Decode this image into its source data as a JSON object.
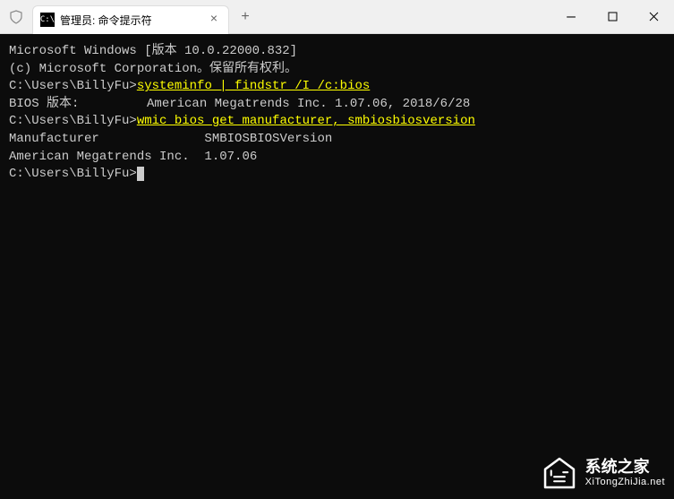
{
  "titlebar": {
    "tab_icon_text": "C:\\",
    "tab_title": "管理员: 命令提示符",
    "close_glyph": "×",
    "new_tab_glyph": "+",
    "minimize_glyph": "—",
    "maximize_glyph": "□",
    "window_close_glyph": "×"
  },
  "terminal": {
    "line1": "Microsoft Windows [版本 10.0.22000.832]",
    "line2": "(c) Microsoft Corporation。保留所有权利。",
    "blank": "",
    "prompt1_prefix": "C:\\Users\\BillyFu>",
    "cmd1": "systeminfo | findstr /I /c:bios",
    "out1": "BIOS 版本:         American Megatrends Inc. 1.07.06, 2018/6/28",
    "prompt2_prefix": "C:\\Users\\BillyFu>",
    "cmd2": "wmic bios get manufacturer, smbiosbiosversion",
    "out2a": "Manufacturer              SMBIOSBIOSVersion",
    "out2b": "American Megatrends Inc.  1.07.06",
    "prompt3_prefix": "C:\\Users\\BillyFu>"
  },
  "watermark": {
    "title": "系统之家",
    "url": "XiTongZhiJia.net"
  }
}
